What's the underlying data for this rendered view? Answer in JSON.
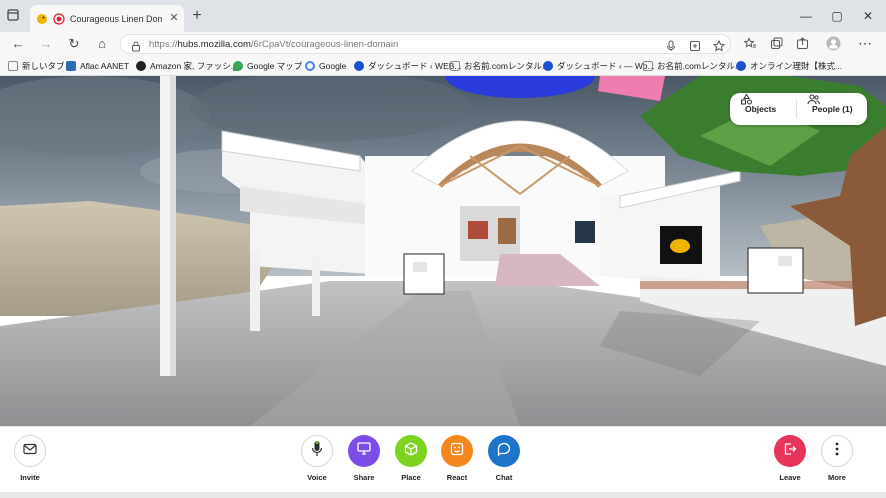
{
  "tab": {
    "title": "Courageous Linen Domain",
    "close_glyph": "✕"
  },
  "newtab_glyph": "+",
  "window": {
    "minimize_glyph": "—",
    "maximize_glyph": "▢",
    "close_glyph": "✕"
  },
  "nav": {
    "back_glyph": "←",
    "forward_glyph": "→",
    "reload_glyph": "↻",
    "home_glyph": "⌂",
    "more_glyph": "⋯"
  },
  "address": {
    "scheme": "https://",
    "host": "hubs.mozilla.com",
    "path": "/6rCpaVt/courageous-linen-domain"
  },
  "bookmarks": [
    {
      "label": "新しいタブ",
      "icon": "page-icon",
      "color": "#6a6a6a"
    },
    {
      "label": "Aflac AANET",
      "icon": "aflac-icon",
      "color": "#2d6bb5"
    },
    {
      "label": "Amazon 家, ファッシ...",
      "icon": "amazon-icon",
      "color": "#222222"
    },
    {
      "label": "Google マップ",
      "icon": "maps-icon",
      "color": "#34a853"
    },
    {
      "label": "Google",
      "icon": "google-icon",
      "color": "#4285f4"
    },
    {
      "label": "ダッシュボード ‹ WEB...",
      "icon": "globe-icon",
      "color": "#1a4fd1"
    },
    {
      "label": "お名前.comレンタル...",
      "icon": "page-icon",
      "color": "#6a6a6a"
    },
    {
      "label": "ダッシュボード ‹ — Wo...",
      "icon": "globe-icon",
      "color": "#1a4fd1"
    },
    {
      "label": "お名前.comレンタル...",
      "icon": "page-icon",
      "color": "#6a6a6a"
    },
    {
      "label": "オンライン理財【株式...",
      "icon": "globe-icon",
      "color": "#1a4fd1"
    }
  ],
  "scene_panel": {
    "objects_label": "Objects",
    "people_label": "People (1)"
  },
  "hub_toolbar": {
    "invite": {
      "label": "Invite",
      "icon": "mail-icon"
    },
    "voice": {
      "label": "Voice",
      "icon": "microphone-icon"
    },
    "share": {
      "label": "Share",
      "icon": "screen-share-icon",
      "color": "#7b4ce8"
    },
    "place": {
      "label": "Place",
      "icon": "cube-icon",
      "color": "#7ed321"
    },
    "react": {
      "label": "React",
      "icon": "emoji-icon",
      "color": "#f5871f"
    },
    "chat": {
      "label": "Chat",
      "icon": "chat-bubble-icon",
      "color": "#1d74c9"
    },
    "leave": {
      "label": "Leave",
      "icon": "exit-icon",
      "color": "#e8345a"
    },
    "more": {
      "label": "More",
      "icon": "more-vertical-icon"
    }
  }
}
